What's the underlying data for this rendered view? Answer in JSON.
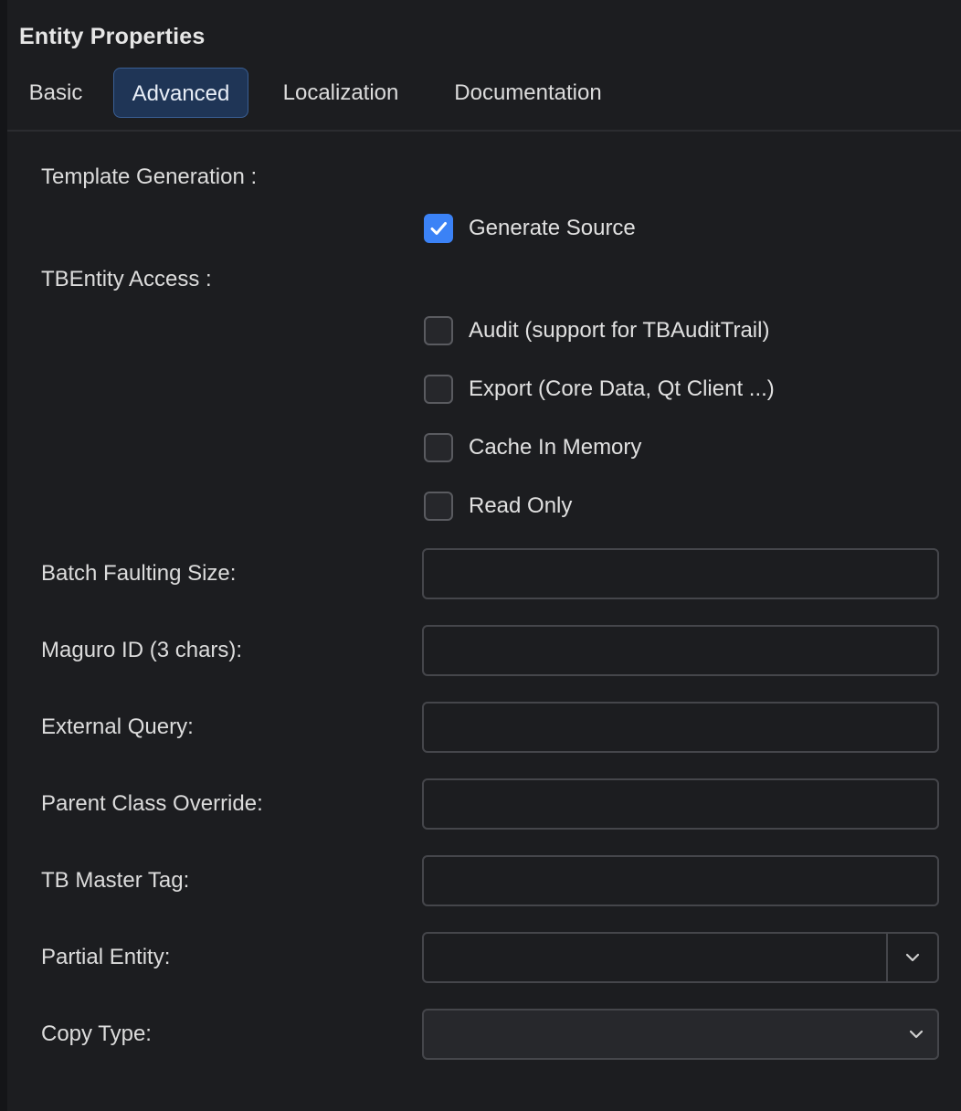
{
  "panel": {
    "title": "Entity Properties"
  },
  "tabs": [
    {
      "label": "Basic",
      "active": false
    },
    {
      "label": "Advanced",
      "active": true
    },
    {
      "label": "Localization",
      "active": false
    },
    {
      "label": "Documentation",
      "active": false
    }
  ],
  "template_generation": {
    "label": "Template Generation :",
    "generate_source": {
      "label": "Generate Source",
      "checked": true
    }
  },
  "tbentity_access": {
    "label": "TBEntity Access :",
    "options": [
      {
        "label": "Audit (support for TBAuditTrail)",
        "checked": false
      },
      {
        "label": "Export (Core Data, Qt Client ...)",
        "checked": false
      },
      {
        "label": "Cache In Memory",
        "checked": false
      },
      {
        "label": "Read Only",
        "checked": false
      }
    ]
  },
  "fields": {
    "batch_faulting_size": {
      "label": "Batch Faulting Size:",
      "value": ""
    },
    "maguro_id": {
      "label": "Maguro ID (3 chars):",
      "value": ""
    },
    "external_query": {
      "label": "External Query:",
      "value": ""
    },
    "parent_class_override": {
      "label": "Parent Class Override:",
      "value": ""
    },
    "tb_master_tag": {
      "label": "TB Master Tag:",
      "value": ""
    },
    "partial_entity": {
      "label": "Partial Entity:",
      "value": ""
    },
    "copy_type": {
      "label": "Copy Type:",
      "value": ""
    }
  },
  "colors": {
    "background": "#1c1d20",
    "accent": "#3b82f6",
    "active_tab_bg": "#1f3556",
    "active_tab_border": "#3a5f94",
    "field_border": "#45464b"
  },
  "icons": {
    "checkmark": "checkmark-icon",
    "dropdown": "chevron-down-icon"
  }
}
